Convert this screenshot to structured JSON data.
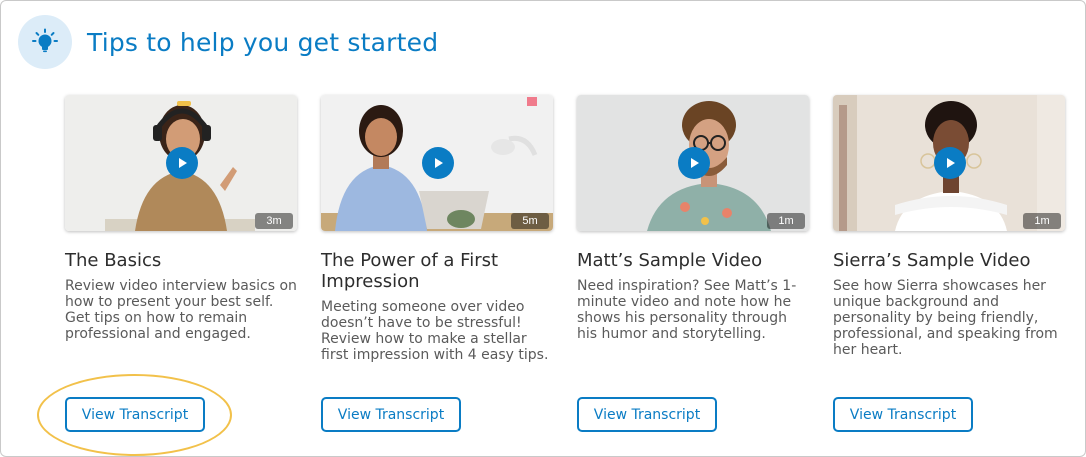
{
  "header": {
    "title": "Tips to help you get started",
    "icon": "lightbulb-icon"
  },
  "accent_color": "#0a7cc4",
  "highlight_color": "#f2c14a",
  "cards": [
    {
      "title": "The Basics",
      "description": "Review video interview basics on how to present your best self. Get tips on how to remain professional and engaged.",
      "duration": "3m",
      "button_label": "View Transcript"
    },
    {
      "title": "The Power of a First Impression",
      "description": "Meeting someone over video doesn’t have to be stressful! Review how to make a stellar first impression with 4 easy tips.",
      "duration": "5m",
      "button_label": "View Transcript"
    },
    {
      "title": "Matt’s Sample Video",
      "description": "Need inspiration? See Matt’s 1-minute video and note how he shows his personality through his humor and storytelling.",
      "duration": "1m",
      "button_label": "View Transcript"
    },
    {
      "title": "Sierra’s Sample Video",
      "description": "See how Sierra showcases her unique background and personality by being friendly, professional, and speaking from her heart.",
      "duration": "1m",
      "button_label": "View Transcript"
    }
  ]
}
